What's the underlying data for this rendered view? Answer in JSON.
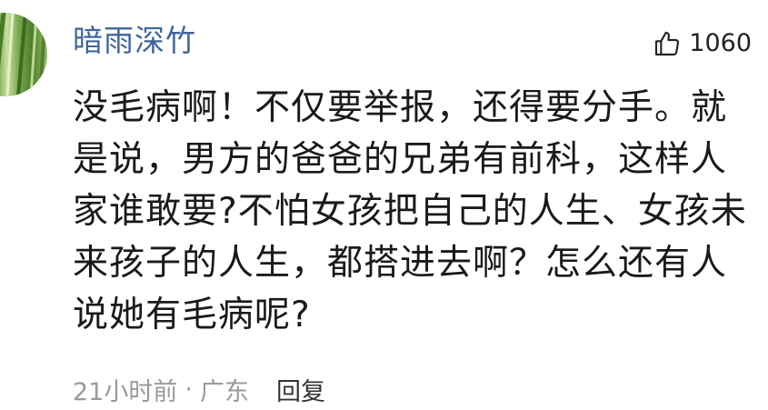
{
  "comment": {
    "username": "暗雨深竹",
    "avatar_icon": "bamboo-avatar-icon",
    "like_icon": "thumbs-up-icon",
    "like_count": "1060",
    "content": "没毛病啊！不仅要举报，还得要分手。就是说，男方的爸爸的兄弟有前科，这样人家谁敢要?不怕女孩把自己的人生、女孩未来孩子的人生，都搭进去啊？怎么还有人说她有毛病呢?",
    "time": "21小时前",
    "separator": "·",
    "location": "广东",
    "reply_label": "回复"
  },
  "colors": {
    "username": "#406599",
    "text": "#1a1a1a",
    "meta": "#999999"
  }
}
